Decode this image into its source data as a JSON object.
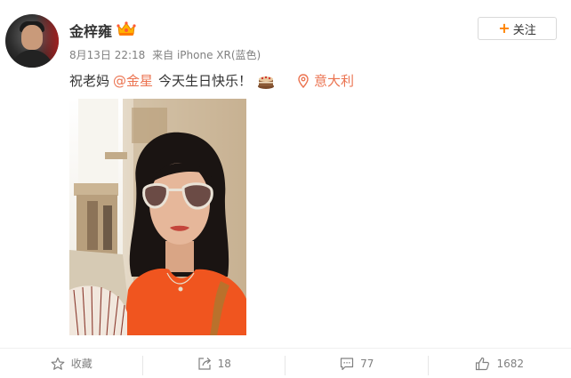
{
  "post": {
    "username": "金梓雍",
    "badge_icon": "vip-crown-icon",
    "meta": {
      "date": "8月13日 22:18",
      "source": "来自 iPhone XR(蓝色)"
    },
    "follow_label": "关注",
    "content": {
      "prefix": "祝老妈",
      "mention": "@金星",
      "suffix": "今天生日快乐！",
      "emoji_icon": "birthday-cake-icon",
      "location": "意大利"
    }
  },
  "actions": {
    "favorite_label": "收藏",
    "repost_count": "18",
    "comment_count": "77",
    "like_count": "1682"
  },
  "colors": {
    "accent_orange": "#ff8200",
    "link_color": "#eb7350",
    "meta_gray": "#808080"
  }
}
